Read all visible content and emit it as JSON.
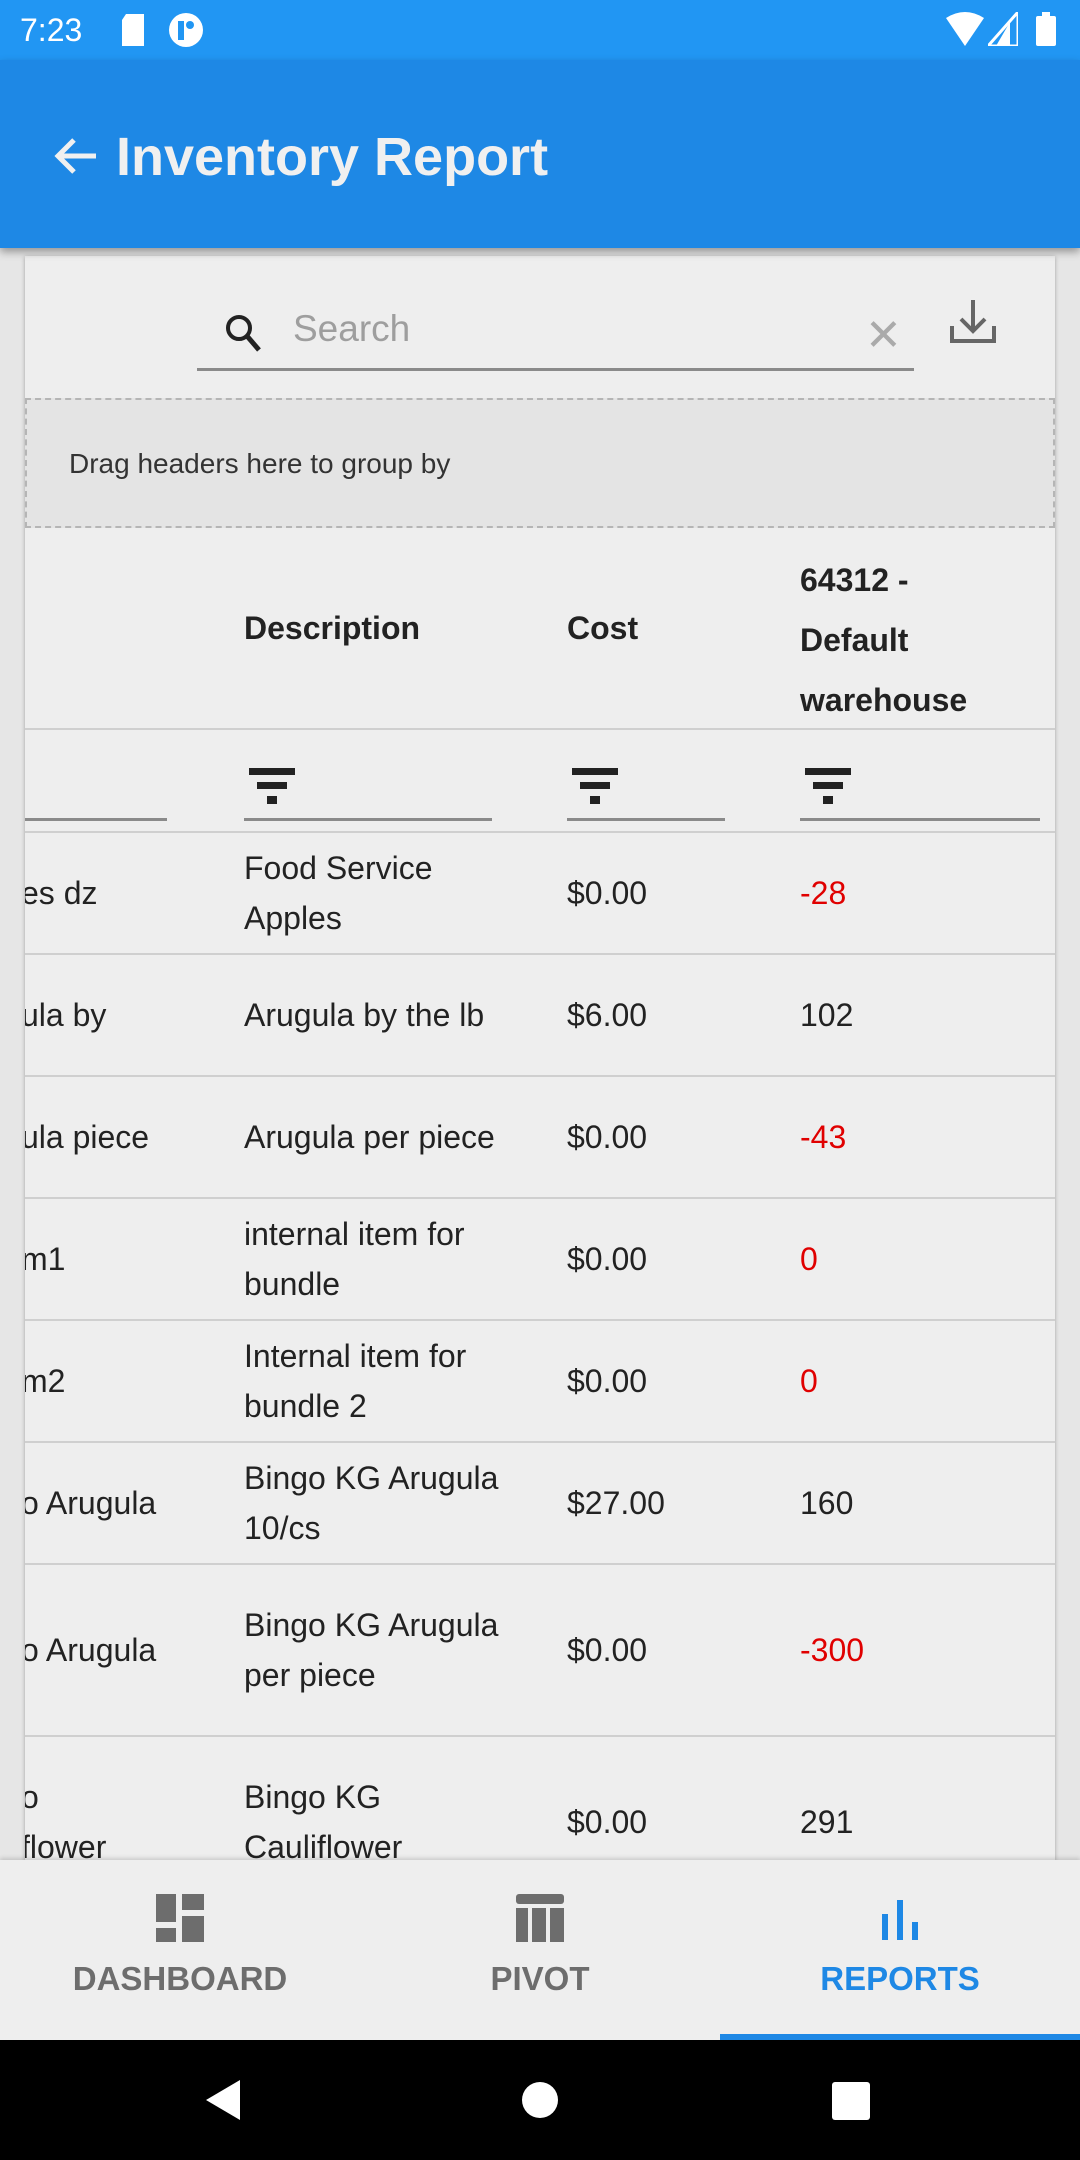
{
  "status": {
    "time": "7:23"
  },
  "appbar": {
    "title": "Inventory Report"
  },
  "search": {
    "placeholder": "Search"
  },
  "group_panel": {
    "text": "Drag headers here to group by"
  },
  "columns": [
    "Description",
    "Cost",
    "64312 - Default warehouse"
  ],
  "rows": [
    {
      "name": "es dz",
      "description": "Food Service Apples",
      "cost": "$0.00",
      "qty": "-28",
      "negative": true
    },
    {
      "name": "ula by",
      "description": "Arugula by the lb",
      "cost": "$6.00",
      "qty": "102",
      "negative": false
    },
    {
      "name": "ula piece",
      "description": "Arugula per piece",
      "cost": "$0.00",
      "qty": "-43",
      "negative": true
    },
    {
      "name": "m1",
      "description": "internal item for bundle",
      "cost": "$0.00",
      "qty": "0",
      "negative": true
    },
    {
      "name": "m2",
      "description": "Internal item for bundle 2",
      "cost": "$0.00",
      "qty": "0",
      "negative": true
    },
    {
      "name": "o Arugula",
      "description": "Bingo KG Arugula 10/cs",
      "cost": "$27.00",
      "qty": "160",
      "negative": false
    },
    {
      "name": "o Arugula",
      "description": "Bingo KG Arugula per piece",
      "cost": "$0.00",
      "qty": "-300",
      "negative": true
    },
    {
      "name": "o\nflower",
      "description": "Bingo KG Cauliflower",
      "cost": "$0.00",
      "qty": "291",
      "negative": false
    }
  ],
  "colors": {
    "primary": "#1e88e5",
    "status_bar": "#2196f3",
    "negative": "#e00000"
  },
  "bottom_nav": [
    {
      "label": "DASHBOARD",
      "icon": "dashboard-icon"
    },
    {
      "label": "PIVOT",
      "icon": "pivot-table-icon"
    },
    {
      "label": "REPORTS",
      "icon": "bar-chart-icon",
      "active": true
    }
  ]
}
